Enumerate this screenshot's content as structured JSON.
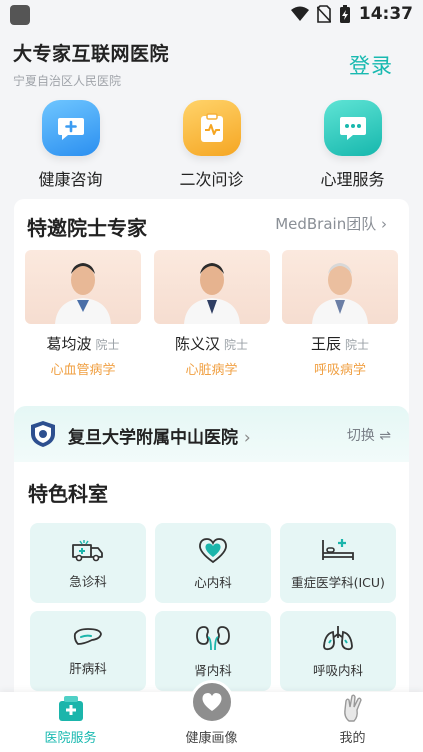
{
  "status_bar": {
    "time": "14:37"
  },
  "header": {
    "title": "大专家互联网医院",
    "subtitle": "宁夏自治区人民医院",
    "login_label": "登录"
  },
  "quick_services": [
    {
      "label": "健康咨询",
      "icon": "chat-plus-icon"
    },
    {
      "label": "二次问诊",
      "icon": "clipboard-pulse-icon"
    },
    {
      "label": "心理服务",
      "icon": "message-dots-icon"
    }
  ],
  "experts_section": {
    "title": "特邀院士专家",
    "more_label": "MedBrain团队",
    "experts": [
      {
        "name": "葛均波",
        "title": "院士",
        "dept": "心血管病学"
      },
      {
        "name": "陈义汉",
        "title": "院士",
        "dept": "心脏病学"
      },
      {
        "name": "王辰",
        "title": "院士",
        "dept": "呼吸病学"
      }
    ]
  },
  "hospital": {
    "name": "复旦大学附属中山医院",
    "switch_label": "切换 ⇌",
    "featured_title": "特色科室",
    "departments": [
      {
        "label": "急诊科",
        "icon": "ambulance-icon"
      },
      {
        "label": "心内科",
        "icon": "heart-icon"
      },
      {
        "label": "重症医学科(ICU)",
        "icon": "hospital-bed-icon"
      },
      {
        "label": "肝病科",
        "icon": "liver-icon"
      },
      {
        "label": "肾内科",
        "icon": "kidney-icon"
      },
      {
        "label": "呼吸内科",
        "icon": "lungs-icon"
      }
    ]
  },
  "bottom_nav": [
    {
      "label": "医院服务",
      "active": true
    },
    {
      "label": "健康画像",
      "active": false
    },
    {
      "label": "我的",
      "active": false
    }
  ],
  "colors": {
    "accent": "#18b9b0",
    "dept_text": "#f0a043"
  }
}
